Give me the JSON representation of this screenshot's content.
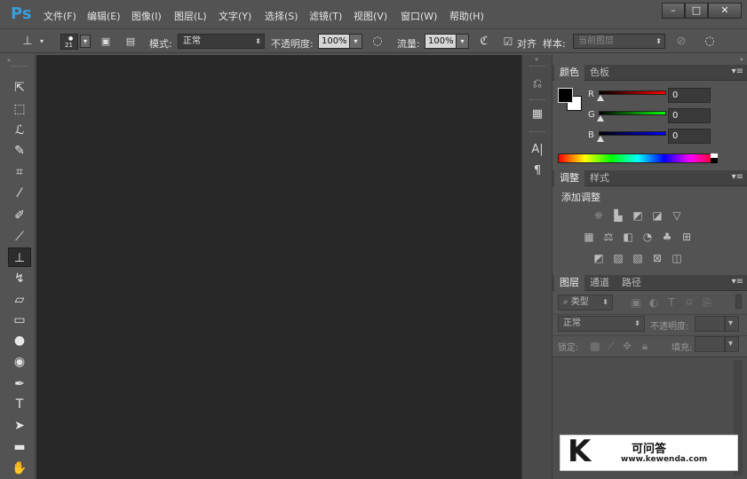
{
  "app": {
    "logo": "Ps"
  },
  "menu": [
    "文件(F)",
    "编辑(E)",
    "图像(I)",
    "图层(L)",
    "文字(Y)",
    "选择(S)",
    "滤镜(T)",
    "视图(V)",
    "窗口(W)",
    "帮助(H)"
  ],
  "window_controls": {
    "minimize": "–",
    "maximize": "□",
    "close": "✕"
  },
  "options": {
    "brush_size": "21",
    "mode_label": "模式:",
    "mode_value": "正常",
    "opacity_label": "不透明度:",
    "opacity_value": "100%",
    "flow_label": "流量:",
    "flow_value": "100%",
    "aligned_label": "对齐",
    "sample_label": "样本:",
    "sample_value": "当前图层"
  },
  "tools": [
    "move-tool",
    "marquee-tool",
    "lasso-tool",
    "quick-select-tool",
    "crop-tool",
    "eyedropper-tool",
    "healing-brush-tool",
    "brush-tool",
    "clone-stamp-tool",
    "history-brush-tool",
    "eraser-tool",
    "gradient-tool",
    "blur-tool",
    "dodge-tool",
    "pen-tool",
    "type-tool",
    "path-select-tool",
    "shape-tool",
    "hand-tool"
  ],
  "color_panel": {
    "tabs": [
      "颜色",
      "色板"
    ],
    "channels": [
      {
        "label": "R",
        "value": "0",
        "color": "#ff0000"
      },
      {
        "label": "G",
        "value": "0",
        "color": "#00ff00"
      },
      {
        "label": "B",
        "value": "0",
        "color": "#0000ff"
      }
    ],
    "foreground": "#000000",
    "background": "#ffffff"
  },
  "adjust_panel": {
    "tabs": [
      "调整",
      "样式"
    ],
    "title": "添加调整"
  },
  "layers_panel": {
    "tabs": [
      "图层",
      "通道",
      "路径"
    ],
    "filter_label": "类型",
    "blend_mode": "正常",
    "opacity_label": "不透明度:",
    "lock_label": "锁定:",
    "fill_label": "填充:"
  },
  "watermark": {
    "brand": "可问答",
    "url": "www.kewenda.com",
    "letter": "K"
  },
  "colors": {
    "accent": "#3d9bd9",
    "canvas": "#282828",
    "panel": "#535353"
  }
}
